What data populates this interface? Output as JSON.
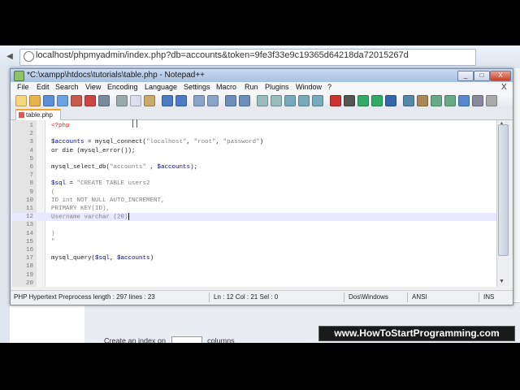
{
  "browser": {
    "url": "localhost/phpmyadmin/index.php?db=accounts&token=9fe3f33e9c19365d64218da72015267d",
    "bg_create_label": "Create an index on",
    "bg_columns_label": "columns"
  },
  "window": {
    "title": "*C:\\xampp\\htdocs\\tutorials\\table.php - Notepad++",
    "buttons": {
      "minimize": "_",
      "maximize": "□",
      "close": "X"
    }
  },
  "menu": {
    "items": [
      "File",
      "Edit",
      "Search",
      "View",
      "Encoding",
      "Language",
      "Settings",
      "Macro",
      "Run",
      "Plugins",
      "Window",
      "?"
    ],
    "close": "X"
  },
  "toolbar": {
    "icons": [
      "new-icon",
      "open-icon",
      "save-icon",
      "save-all-icon",
      "close-icon",
      "close-all-icon",
      "print-icon",
      "cut-icon",
      "copy-icon",
      "paste-icon",
      "undo-icon",
      "redo-icon",
      "find-icon",
      "replace-icon",
      "zoom-in-icon",
      "zoom-out-icon",
      "sync-v-icon",
      "sync-h-icon",
      "wrap-icon",
      "all-chars-icon",
      "indent-guide-icon",
      "record-icon",
      "stop-icon",
      "play-icon",
      "play-multi-icon",
      "save-macro-icon",
      "func-list-icon",
      "spellcheck-icon",
      "up-icon",
      "down-icon",
      "doc-map-icon",
      "settings-icon",
      "trash-icon"
    ]
  },
  "tab": {
    "label": "table.php"
  },
  "editor": {
    "lines": [
      {
        "n": "1",
        "parts": [
          [
            "php",
            "<?php"
          ]
        ]
      },
      {
        "n": "2",
        "parts": []
      },
      {
        "n": "3",
        "parts": [
          [
            "var",
            "$accounts"
          ],
          [
            "txt",
            " = mysql_connect("
          ],
          [
            "str",
            "\"localhost\""
          ],
          [
            "txt",
            ", "
          ],
          [
            "str",
            "\"root\""
          ],
          [
            "txt",
            ", "
          ],
          [
            "str",
            "\"password\""
          ],
          [
            "txt",
            ")"
          ]
        ]
      },
      {
        "n": "4",
        "parts": [
          [
            "txt",
            "or die (mysql_error());"
          ]
        ]
      },
      {
        "n": "5",
        "parts": []
      },
      {
        "n": "6",
        "parts": [
          [
            "txt",
            "mysql_select_db("
          ],
          [
            "str",
            "\"accounts\""
          ],
          [
            "txt",
            " , "
          ],
          [
            "var",
            "$accounts"
          ],
          [
            "txt",
            ");"
          ]
        ]
      },
      {
        "n": "7",
        "parts": []
      },
      {
        "n": "8",
        "parts": [
          [
            "var",
            "$sql"
          ],
          [
            "txt",
            " = "
          ],
          [
            "str",
            "\"CREATE TABLE users2"
          ]
        ]
      },
      {
        "n": "9",
        "parts": [
          [
            "str",
            "("
          ]
        ]
      },
      {
        "n": "10",
        "parts": [
          [
            "str",
            "ID int NOT NULL AUTO_INCREMENT,"
          ]
        ]
      },
      {
        "n": "11",
        "parts": [
          [
            "str",
            "PRIMARY KEY(ID),"
          ]
        ]
      },
      {
        "n": "12",
        "parts": [
          [
            "str",
            "Username varchar (20)"
          ]
        ]
      },
      {
        "n": "13",
        "parts": []
      },
      {
        "n": "14",
        "parts": [
          [
            "str",
            ")"
          ]
        ]
      },
      {
        "n": "15",
        "parts": [
          [
            "str",
            "\""
          ]
        ]
      },
      {
        "n": "16",
        "parts": []
      },
      {
        "n": "17",
        "parts": [
          [
            "txt",
            "mysql_query("
          ],
          [
            "var",
            "$sql"
          ],
          [
            "txt",
            ", "
          ],
          [
            "var",
            "$accounts"
          ],
          [
            "txt",
            ")"
          ]
        ]
      },
      {
        "n": "18",
        "parts": []
      },
      {
        "n": "19",
        "parts": []
      },
      {
        "n": "20",
        "parts": []
      }
    ],
    "current_line": 12
  },
  "status": {
    "file_type": "PHP Hypertext Preprocess length : 297    lines : 23",
    "position": "Ln : 12    Col : 21    Sel : 0",
    "eol": "Dos\\Windows",
    "encoding": "ANSI",
    "mode": "INS"
  },
  "watermark": "www.HowToStartProgramming.com"
}
